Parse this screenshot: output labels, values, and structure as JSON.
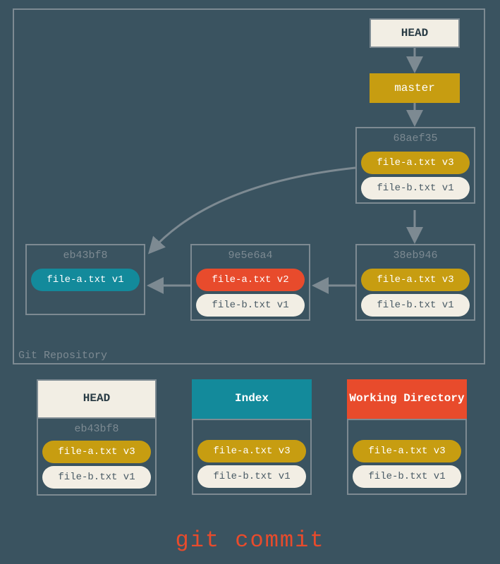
{
  "repo": {
    "label": "Git Repository",
    "head_label": "HEAD",
    "master_label": "master",
    "commits": {
      "top": {
        "hash": "68aef35",
        "file_a": "file-a.txt v3",
        "file_b": "file-b.txt v1"
      },
      "left": {
        "hash": "eb43bf8",
        "file_a": "file-a.txt v1"
      },
      "mid": {
        "hash": "9e5e6a4",
        "file_a": "file-a.txt v2",
        "file_b": "file-b.txt v1"
      },
      "right": {
        "hash": "38eb946",
        "file_a": "file-a.txt v3",
        "file_b": "file-b.txt v1"
      }
    }
  },
  "bottom": {
    "head": {
      "title": "HEAD",
      "hash": "eb43bf8",
      "file_a": "file-a.txt v3",
      "file_b": "file-b.txt v1"
    },
    "index": {
      "title": "Index",
      "file_a": "file-a.txt v3",
      "file_b": "file-b.txt v1"
    },
    "wd": {
      "title": "Working Directory",
      "file_a": "file-a.txt v3",
      "file_b": "file-b.txt v1"
    }
  },
  "command": "git commit"
}
